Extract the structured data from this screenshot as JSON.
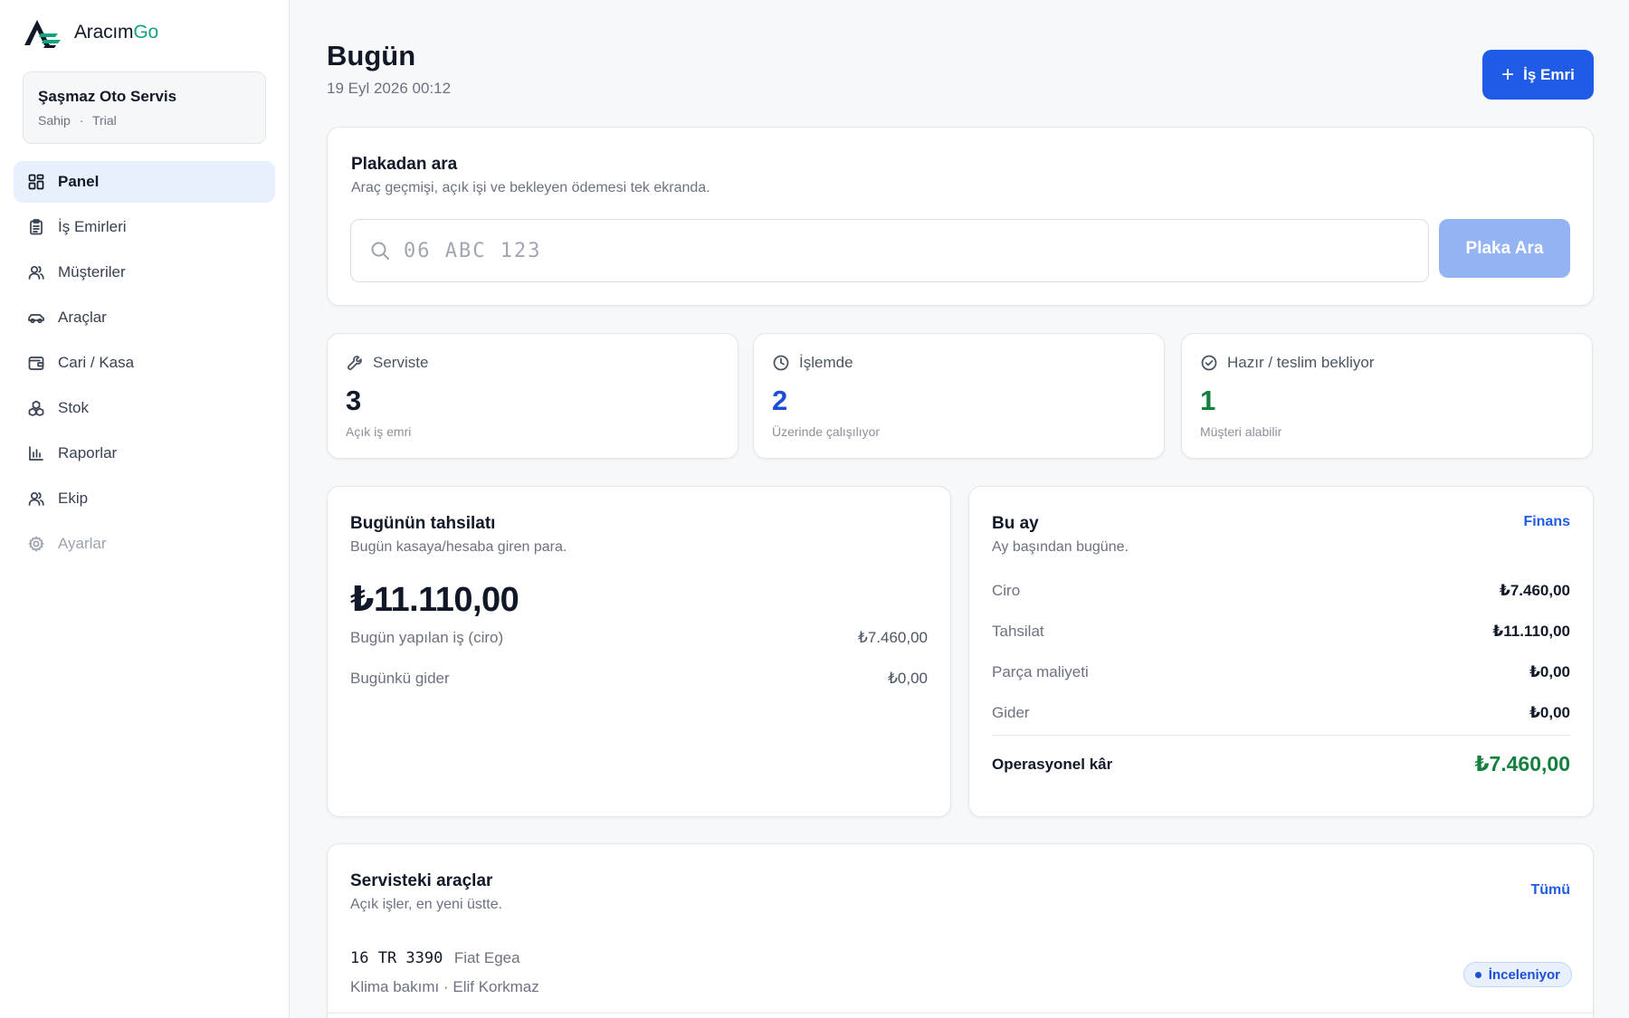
{
  "brand": {
    "name_main": "Aracım",
    "name_accent": "Go",
    "accent_color": "#14a37f",
    "primary_color": "#1f5be6"
  },
  "org": {
    "name": "Şaşmaz Oto Servis",
    "role": "Sahip",
    "plan": "Trial",
    "separator": "·"
  },
  "nav": [
    {
      "label": "Panel",
      "icon": "dashboard-icon",
      "active": true
    },
    {
      "label": "İş Emirleri",
      "icon": "clipboard-icon"
    },
    {
      "label": "Müşteriler",
      "icon": "users-icon"
    },
    {
      "label": "Araçlar",
      "icon": "car-icon"
    },
    {
      "label": "Cari / Kasa",
      "icon": "wallet-icon"
    },
    {
      "label": "Stok",
      "icon": "boxes-icon"
    },
    {
      "label": "Raporlar",
      "icon": "bar-chart-icon"
    },
    {
      "label": "Ekip",
      "icon": "team-icon"
    },
    {
      "label": "Ayarlar",
      "icon": "gear-icon",
      "disabled": true
    }
  ],
  "header": {
    "title": "Bugün",
    "date": "19 Eyl 2026 00:12",
    "new_button_plus": "+",
    "new_button_label": "İş Emri"
  },
  "search": {
    "title": "Plakadan ara",
    "subtitle": "Araç geçmişi, açık işi ve bekleyen ödemesi tek ekranda.",
    "placeholder": "06 ABC 123",
    "button_label": "Plaka Ara"
  },
  "stats": [
    {
      "label": "Serviste",
      "value": "3",
      "caption": "Açık iş emri",
      "icon": "wrench-icon",
      "color": "#111827"
    },
    {
      "label": "İşlemde",
      "value": "2",
      "caption": "Üzerinde çalışılıyor",
      "icon": "clock-icon",
      "color": "#1d4ed8"
    },
    {
      "label": "Hazır / teslim bekliyor",
      "value": "1",
      "caption": "Müşteri alabilir",
      "icon": "check-circle-icon",
      "color": "#15803d"
    }
  ],
  "today_collection": {
    "title": "Bugünün tahsilatı",
    "subtitle": "Bugün kasaya/hesaba giren para.",
    "amount": "₺11.110,00",
    "rows": [
      {
        "label": "Bugün yapılan iş (ciro)",
        "value": "₺7.460,00"
      },
      {
        "label": "Bugünkü gider",
        "value": "₺0,00"
      }
    ]
  },
  "this_month": {
    "title": "Bu ay",
    "subtitle": "Ay başından bugüne.",
    "link": "Finans",
    "rows": [
      {
        "label": "Ciro",
        "value": "₺7.460,00"
      },
      {
        "label": "Tahsilat",
        "value": "₺11.110,00"
      },
      {
        "label": "Parça maliyeti",
        "value": "₺0,00"
      },
      {
        "label": "Gider",
        "value": "₺0,00"
      }
    ],
    "profit_label": "Operasyonel kâr",
    "profit_value": "₺7.460,00"
  },
  "vehicles": {
    "title": "Servisteki araçlar",
    "subtitle": "Açık işler, en yeni üstte.",
    "link": "Tümü",
    "items": [
      {
        "plate": "16 TR 3390",
        "model": "Fiat Egea",
        "detail": "Klima bakımı · Elif Korkmaz",
        "status": "İnceleniyor"
      }
    ]
  }
}
